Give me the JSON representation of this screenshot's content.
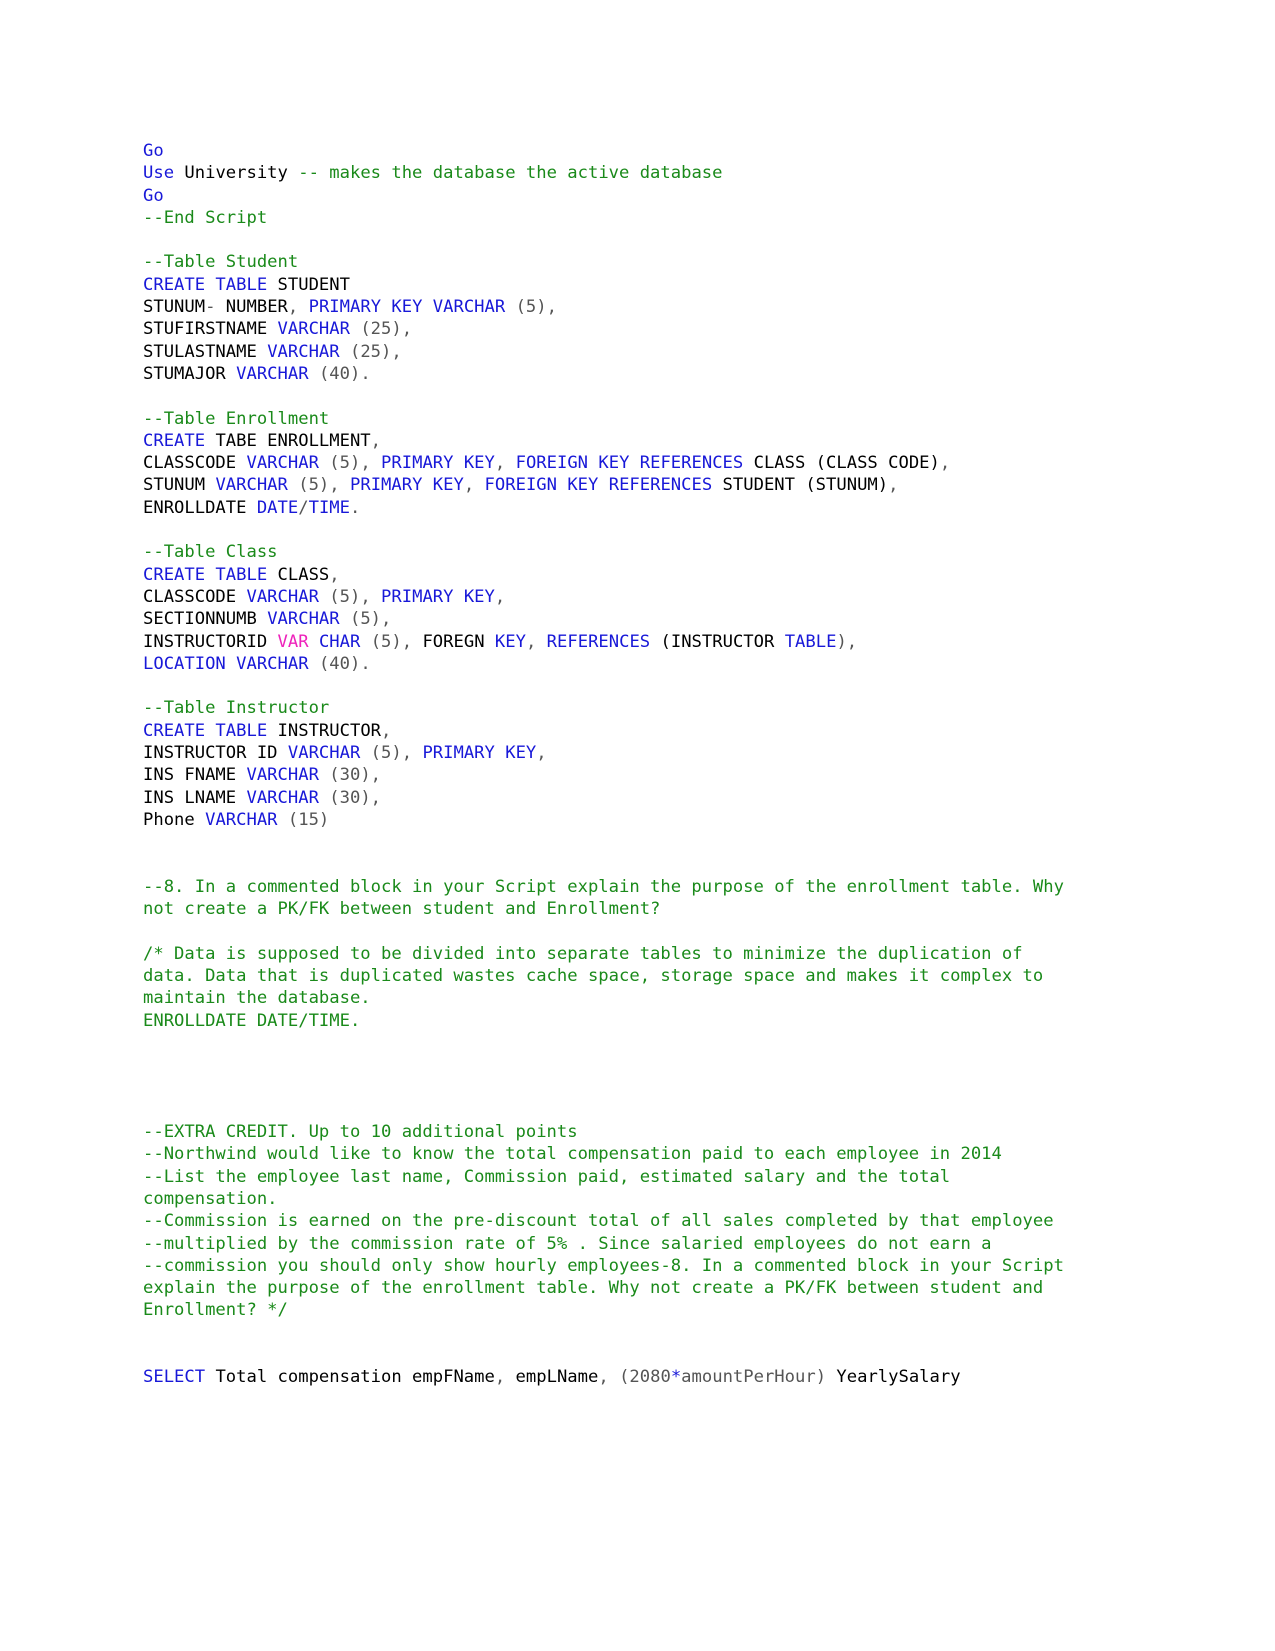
{
  "document": {
    "type": "sql-script",
    "title": "University database SQL script",
    "colors": {
      "keyword": "#1818d8",
      "comment": "#1a8a1a",
      "plain": "#000000",
      "number": "#555555",
      "magenta": "#ee22bb",
      "background": "#ffffff"
    }
  },
  "lines": [
    {
      "id": "l1",
      "tokens": [
        {
          "t": "Go",
          "c": "kw"
        }
      ]
    },
    {
      "id": "l2",
      "tokens": [
        {
          "t": "Use",
          "c": "kw"
        },
        {
          "t": " University ",
          "c": "pln"
        },
        {
          "t": "-- makes the database the active database",
          "c": "cmt"
        }
      ]
    },
    {
      "id": "l3",
      "tokens": [
        {
          "t": "Go",
          "c": "kw"
        }
      ]
    },
    {
      "id": "l4",
      "tokens": [
        {
          "t": "--End Script",
          "c": "cmt"
        }
      ]
    },
    {
      "id": "l5",
      "tokens": []
    },
    {
      "id": "l6",
      "tokens": [
        {
          "t": "--Table Student",
          "c": "cmt"
        }
      ]
    },
    {
      "id": "l7",
      "tokens": [
        {
          "t": "CREATE TABLE",
          "c": "kw"
        },
        {
          "t": " STUDENT",
          "c": "pln"
        }
      ]
    },
    {
      "id": "l8",
      "tokens": [
        {
          "t": "STUNUM",
          "c": "pln"
        },
        {
          "t": "-",
          "c": "num"
        },
        {
          "t": " NUMBER",
          "c": "pln"
        },
        {
          "t": ",",
          "c": "num"
        },
        {
          "t": " ",
          "c": "pln"
        },
        {
          "t": "PRIMARY KEY VARCHAR",
          "c": "kw"
        },
        {
          "t": " ",
          "c": "pln"
        },
        {
          "t": "(5),",
          "c": "num"
        }
      ]
    },
    {
      "id": "l9",
      "tokens": [
        {
          "t": "STUFIRSTNAME ",
          "c": "pln"
        },
        {
          "t": "VARCHAR",
          "c": "kw"
        },
        {
          "t": " ",
          "c": "pln"
        },
        {
          "t": "(25),",
          "c": "num"
        }
      ]
    },
    {
      "id": "l10",
      "tokens": [
        {
          "t": "STULASTNAME ",
          "c": "pln"
        },
        {
          "t": "VARCHAR",
          "c": "kw"
        },
        {
          "t": " ",
          "c": "pln"
        },
        {
          "t": "(25),",
          "c": "num"
        }
      ]
    },
    {
      "id": "l11",
      "tokens": [
        {
          "t": "STUMAJOR ",
          "c": "pln"
        },
        {
          "t": "VARCHAR",
          "c": "kw"
        },
        {
          "t": " ",
          "c": "pln"
        },
        {
          "t": "(40).",
          "c": "num"
        }
      ]
    },
    {
      "id": "l12",
      "tokens": []
    },
    {
      "id": "l13",
      "tokens": [
        {
          "t": "--Table Enrollment",
          "c": "cmt"
        }
      ]
    },
    {
      "id": "l14",
      "tokens": [
        {
          "t": "CREATE",
          "c": "kw"
        },
        {
          "t": " TABE ENROLLMENT",
          "c": "pln"
        },
        {
          "t": ",",
          "c": "num"
        }
      ]
    },
    {
      "id": "l15",
      "tokens": [
        {
          "t": "CLASSCODE ",
          "c": "pln"
        },
        {
          "t": "VARCHAR",
          "c": "kw"
        },
        {
          "t": " ",
          "c": "pln"
        },
        {
          "t": "(5),",
          "c": "num"
        },
        {
          "t": " ",
          "c": "pln"
        },
        {
          "t": "PRIMARY KEY",
          "c": "kw"
        },
        {
          "t": ",",
          "c": "num"
        },
        {
          "t": " ",
          "c": "pln"
        },
        {
          "t": "FOREIGN KEY REFERENCES",
          "c": "kw"
        },
        {
          "t": " CLASS (CLASS CODE)",
          "c": "pln"
        },
        {
          "t": ",",
          "c": "num"
        }
      ]
    },
    {
      "id": "l16",
      "tokens": [
        {
          "t": "STUNUM ",
          "c": "pln"
        },
        {
          "t": "VARCHAR",
          "c": "kw"
        },
        {
          "t": " ",
          "c": "pln"
        },
        {
          "t": "(5),",
          "c": "num"
        },
        {
          "t": " ",
          "c": "pln"
        },
        {
          "t": "PRIMARY KEY",
          "c": "kw"
        },
        {
          "t": ",",
          "c": "num"
        },
        {
          "t": " ",
          "c": "pln"
        },
        {
          "t": "FOREIGN KEY REFERENCES",
          "c": "kw"
        },
        {
          "t": " STUDENT (STUNUM)",
          "c": "pln"
        },
        {
          "t": ",",
          "c": "num"
        }
      ]
    },
    {
      "id": "l17",
      "tokens": [
        {
          "t": "ENROLLDATE ",
          "c": "pln"
        },
        {
          "t": "DATE",
          "c": "kw"
        },
        {
          "t": "/",
          "c": "num"
        },
        {
          "t": "TIME",
          "c": "kw"
        },
        {
          "t": ".",
          "c": "num"
        }
      ]
    },
    {
      "id": "l18",
      "tokens": []
    },
    {
      "id": "l19",
      "tokens": [
        {
          "t": "--Table Class",
          "c": "cmt"
        }
      ]
    },
    {
      "id": "l20",
      "tokens": [
        {
          "t": "CREATE TABLE",
          "c": "kw"
        },
        {
          "t": " CLASS",
          "c": "pln"
        },
        {
          "t": ",",
          "c": "num"
        }
      ]
    },
    {
      "id": "l21",
      "tokens": [
        {
          "t": "CLASSCODE ",
          "c": "pln"
        },
        {
          "t": "VARCHAR",
          "c": "kw"
        },
        {
          "t": " ",
          "c": "pln"
        },
        {
          "t": "(5),",
          "c": "num"
        },
        {
          "t": " ",
          "c": "pln"
        },
        {
          "t": "PRIMARY KEY",
          "c": "kw"
        },
        {
          "t": ",",
          "c": "num"
        }
      ]
    },
    {
      "id": "l22",
      "tokens": [
        {
          "t": "SECTIONNUMB ",
          "c": "pln"
        },
        {
          "t": "VARCHAR",
          "c": "kw"
        },
        {
          "t": " ",
          "c": "pln"
        },
        {
          "t": "(5),",
          "c": "num"
        }
      ]
    },
    {
      "id": "l23",
      "tokens": [
        {
          "t": "INSTRUCTORID ",
          "c": "pln"
        },
        {
          "t": "VAR",
          "c": "mag"
        },
        {
          "t": " ",
          "c": "pln"
        },
        {
          "t": "CHAR",
          "c": "kw"
        },
        {
          "t": " ",
          "c": "pln"
        },
        {
          "t": "(5),",
          "c": "num"
        },
        {
          "t": " FOREGN ",
          "c": "pln"
        },
        {
          "t": "KEY",
          "c": "kw"
        },
        {
          "t": ",",
          "c": "num"
        },
        {
          "t": " ",
          "c": "pln"
        },
        {
          "t": "REFERENCES",
          "c": "kw"
        },
        {
          "t": " (INSTRUCTOR ",
          "c": "pln"
        },
        {
          "t": "TABLE",
          "c": "kw"
        },
        {
          "t": "),",
          "c": "num"
        }
      ]
    },
    {
      "id": "l24",
      "tokens": [
        {
          "t": "LOCATION VARCHAR",
          "c": "kw"
        },
        {
          "t": " ",
          "c": "pln"
        },
        {
          "t": "(40).",
          "c": "num"
        }
      ]
    },
    {
      "id": "l25",
      "tokens": []
    },
    {
      "id": "l26",
      "tokens": [
        {
          "t": "--Table Instructor",
          "c": "cmt"
        }
      ]
    },
    {
      "id": "l27",
      "tokens": [
        {
          "t": "CREATE TABLE",
          "c": "kw"
        },
        {
          "t": " INSTRUCTOR",
          "c": "pln"
        },
        {
          "t": ",",
          "c": "num"
        }
      ]
    },
    {
      "id": "l28",
      "tokens": [
        {
          "t": "INSTRUCTOR ID ",
          "c": "pln"
        },
        {
          "t": "VARCHAR",
          "c": "kw"
        },
        {
          "t": " ",
          "c": "pln"
        },
        {
          "t": "(5),",
          "c": "num"
        },
        {
          "t": " ",
          "c": "pln"
        },
        {
          "t": "PRIMARY KEY",
          "c": "kw"
        },
        {
          "t": ",",
          "c": "num"
        }
      ]
    },
    {
      "id": "l29",
      "tokens": [
        {
          "t": "INS FNAME ",
          "c": "pln"
        },
        {
          "t": "VARCHAR",
          "c": "kw"
        },
        {
          "t": " ",
          "c": "pln"
        },
        {
          "t": "(30),",
          "c": "num"
        }
      ]
    },
    {
      "id": "l30",
      "tokens": [
        {
          "t": "INS LNAME ",
          "c": "pln"
        },
        {
          "t": "VARCHAR",
          "c": "kw"
        },
        {
          "t": " ",
          "c": "pln"
        },
        {
          "t": "(30),",
          "c": "num"
        }
      ]
    },
    {
      "id": "l31",
      "tokens": [
        {
          "t": "Phone ",
          "c": "pln"
        },
        {
          "t": "VARCHAR",
          "c": "kw"
        },
        {
          "t": " ",
          "c": "pln"
        },
        {
          "t": "(15)",
          "c": "num"
        }
      ]
    },
    {
      "id": "l32",
      "tokens": []
    },
    {
      "id": "l33",
      "tokens": []
    },
    {
      "id": "l34",
      "tokens": [
        {
          "t": "--8. In a commented block in your Script explain the purpose of the enrollment table. Why not create a PK/FK between student and Enrollment?",
          "c": "cmt"
        }
      ]
    },
    {
      "id": "l35",
      "tokens": []
    },
    {
      "id": "l36",
      "tokens": [
        {
          "t": "/* Data is supposed to be divided into separate tables to minimize the duplication of data. Data that is duplicated wastes cache space, storage space and makes it complex to maintain the database.",
          "c": "cmt"
        }
      ]
    },
    {
      "id": "l37",
      "tokens": [
        {
          "t": "ENROLLDATE DATE/TIME.",
          "c": "cmt"
        }
      ]
    },
    {
      "id": "l38",
      "tokens": []
    },
    {
      "id": "l39",
      "tokens": []
    },
    {
      "id": "l40",
      "tokens": []
    },
    {
      "id": "l41",
      "tokens": []
    },
    {
      "id": "l42",
      "tokens": [
        {
          "t": "--EXTRA CREDIT. Up to 10 additional points",
          "c": "cmt"
        }
      ]
    },
    {
      "id": "l43",
      "tokens": [
        {
          "t": "--Northwind would like to know the total compensation paid to each employee in 2014",
          "c": "cmt"
        }
      ]
    },
    {
      "id": "l44",
      "tokens": [
        {
          "t": "--List the employee last name, Commission paid, estimated salary and the total compensation.",
          "c": "cmt"
        }
      ]
    },
    {
      "id": "l45",
      "tokens": [
        {
          "t": "--Commission is earned on the pre-discount total of all sales completed by that employee",
          "c": "cmt"
        }
      ]
    },
    {
      "id": "l46",
      "tokens": [
        {
          "t": "--multiplied by the commission rate of 5% . Since salaried employees do not earn a",
          "c": "cmt"
        }
      ]
    },
    {
      "id": "l47",
      "tokens": [
        {
          "t": "--commission you should only show hourly employees-8. In a commented block in your Script explain the purpose of the enrollment table. Why not create a PK/FK between student and Enrollment? */",
          "c": "cmt"
        }
      ]
    },
    {
      "id": "l48",
      "tokens": []
    },
    {
      "id": "l49",
      "tokens": []
    },
    {
      "id": "l50",
      "tokens": [
        {
          "t": "SELECT",
          "c": "kw"
        },
        {
          "t": " Total compensation empFName",
          "c": "pln"
        },
        {
          "t": ",",
          "c": "num"
        },
        {
          "t": " empLName",
          "c": "pln"
        },
        {
          "t": ",",
          "c": "num"
        },
        {
          "t": " ",
          "c": "pln"
        },
        {
          "t": "(2080",
          "c": "num"
        },
        {
          "t": "*",
          "c": "kw"
        },
        {
          "t": "amountPerHour)",
          "c": "num"
        },
        {
          "t": " YearlySalary",
          "c": "pln"
        }
      ]
    }
  ]
}
